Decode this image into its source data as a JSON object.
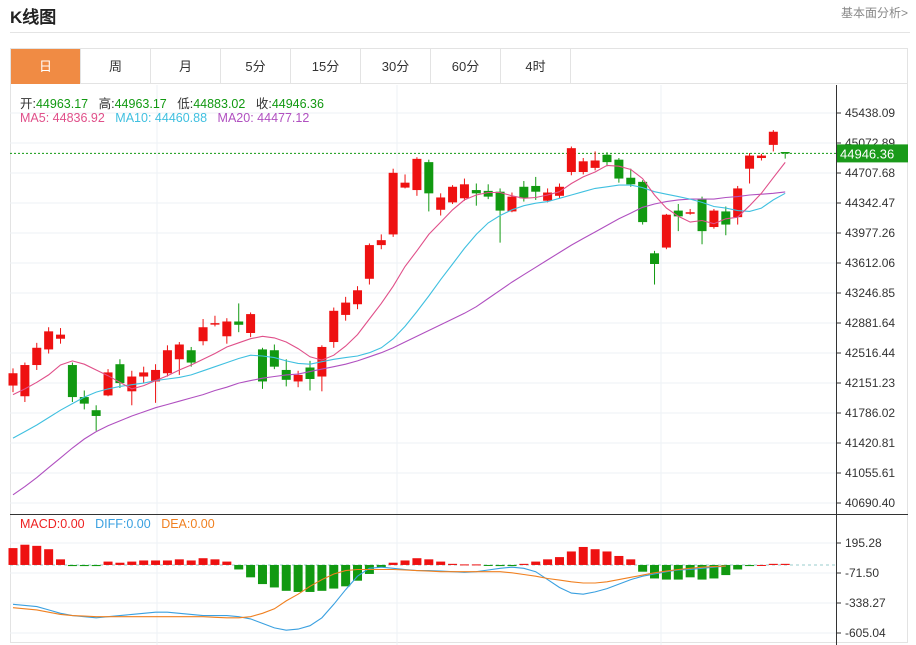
{
  "header": {
    "title": "K线图",
    "link": "基本面分析>"
  },
  "tabs": [
    {
      "label": "日",
      "active": true
    },
    {
      "label": "周",
      "active": false
    },
    {
      "label": "月",
      "active": false
    },
    {
      "label": "5分",
      "active": false
    },
    {
      "label": "15分",
      "active": false
    },
    {
      "label": "30分",
      "active": false
    },
    {
      "label": "60分",
      "active": false
    },
    {
      "label": "4时",
      "active": false
    }
  ],
  "ohlc_info": {
    "open_label": "开:",
    "open": "44963.17",
    "high_label": "高:",
    "high": "44963.17",
    "low_label": "低:",
    "low": "44883.02",
    "close_label": "收:",
    "close": "44946.36"
  },
  "ma_info": {
    "ma5_label": "MA5:",
    "ma5": "44836.92",
    "ma10_label": "MA10:",
    "ma10": "44460.88",
    "ma20_label": "MA20:",
    "ma20": "44477.12"
  },
  "macd_info": {
    "macd_label": "MACD:",
    "macd": "0.00",
    "diff_label": "DIFF:",
    "diff": "0.00",
    "dea_label": "DEA:",
    "dea": "0.00"
  },
  "colors": {
    "up": "#ee1111",
    "down": "#119911",
    "ma5": "#e0508a",
    "ma10": "#40c0e0",
    "ma20": "#b050c0",
    "diff": "#3aa0e0",
    "dea": "#f08020",
    "last_price_bg": "#1a9a1a"
  },
  "chart_data": {
    "type": "candlestick",
    "main_axis": {
      "ylim": [
        40690.4,
        45438.09
      ],
      "ticks": [
        "45438.09",
        "45072.89",
        "44707.68",
        "44342.47",
        "43977.26",
        "43612.06",
        "43246.85",
        "42881.64",
        "42516.44",
        "42151.23",
        "41786.02",
        "41420.81",
        "41055.61",
        "40690.40"
      ],
      "last_price_label": "44946.36",
      "last_price": 44946.36
    },
    "candles": [
      {
        "o": 42120,
        "c": 42270,
        "h": 42330,
        "l": 42040
      },
      {
        "o": 41990,
        "c": 42370,
        "h": 42400,
        "l": 41920
      },
      {
        "o": 42370,
        "c": 42580,
        "h": 42640,
        "l": 42310
      },
      {
        "o": 42560,
        "c": 42780,
        "h": 42830,
        "l": 42510
      },
      {
        "o": 42690,
        "c": 42740,
        "h": 42820,
        "l": 42630
      },
      {
        "o": 42370,
        "c": 41980,
        "h": 42400,
        "l": 41920
      },
      {
        "o": 41980,
        "c": 41900,
        "h": 42060,
        "l": 41830
      },
      {
        "o": 41820,
        "c": 41750,
        "h": 41880,
        "l": 41570
      },
      {
        "o": 42000,
        "c": 42280,
        "h": 42320,
        "l": 41990
      },
      {
        "o": 42380,
        "c": 42150,
        "h": 42440,
        "l": 42090
      },
      {
        "o": 42050,
        "c": 42230,
        "h": 42300,
        "l": 41880
      },
      {
        "o": 42230,
        "c": 42280,
        "h": 42350,
        "l": 42150
      },
      {
        "o": 42170,
        "c": 42310,
        "h": 42380,
        "l": 41910
      },
      {
        "o": 42270,
        "c": 42550,
        "h": 42610,
        "l": 42230
      },
      {
        "o": 42440,
        "c": 42620,
        "h": 42650,
        "l": 42250
      },
      {
        "o": 42550,
        "c": 42400,
        "h": 42590,
        "l": 42350
      },
      {
        "o": 42660,
        "c": 42830,
        "h": 42930,
        "l": 42610
      },
      {
        "o": 42880,
        "c": 42880,
        "h": 42970,
        "l": 42840
      },
      {
        "o": 42720,
        "c": 42900,
        "h": 42940,
        "l": 42630
      },
      {
        "o": 42900,
        "c": 42860,
        "h": 43120,
        "l": 42770
      },
      {
        "o": 42760,
        "c": 42990,
        "h": 43010,
        "l": 42710
      },
      {
        "o": 42560,
        "c": 42170,
        "h": 42580,
        "l": 42080
      },
      {
        "o": 42550,
        "c": 42350,
        "h": 42620,
        "l": 42320
      },
      {
        "o": 42310,
        "c": 42190,
        "h": 42440,
        "l": 42110
      },
      {
        "o": 42170,
        "c": 42250,
        "h": 42300,
        "l": 42100
      },
      {
        "o": 42340,
        "c": 42200,
        "h": 42420,
        "l": 42060
      },
      {
        "o": 42230,
        "c": 42590,
        "h": 42610,
        "l": 42050
      },
      {
        "o": 42650,
        "c": 43030,
        "h": 43070,
        "l": 42580
      },
      {
        "o": 42980,
        "c": 43130,
        "h": 43200,
        "l": 42910
      },
      {
        "o": 43110,
        "c": 43280,
        "h": 43330,
        "l": 43050
      },
      {
        "o": 43420,
        "c": 43830,
        "h": 43850,
        "l": 43350
      },
      {
        "o": 43830,
        "c": 43890,
        "h": 43960,
        "l": 43780
      },
      {
        "o": 43960,
        "c": 44710,
        "h": 44760,
        "l": 43930
      },
      {
        "o": 44530,
        "c": 44590,
        "h": 44690,
        "l": 44520
      },
      {
        "o": 44500,
        "c": 44880,
        "h": 44900,
        "l": 44430
      },
      {
        "o": 44840,
        "c": 44460,
        "h": 44870,
        "l": 44240
      },
      {
        "o": 44260,
        "c": 44410,
        "h": 44460,
        "l": 44190
      },
      {
        "o": 44350,
        "c": 44540,
        "h": 44560,
        "l": 44330
      },
      {
        "o": 44400,
        "c": 44570,
        "h": 44640,
        "l": 44370
      },
      {
        "o": 44500,
        "c": 44460,
        "h": 44580,
        "l": 44310
      },
      {
        "o": 44490,
        "c": 44420,
        "h": 44570,
        "l": 44390
      },
      {
        "o": 44480,
        "c": 44250,
        "h": 44520,
        "l": 43860
      },
      {
        "o": 44240,
        "c": 44420,
        "h": 44470,
        "l": 44230
      },
      {
        "o": 44540,
        "c": 44400,
        "h": 44610,
        "l": 44360
      },
      {
        "o": 44550,
        "c": 44480,
        "h": 44660,
        "l": 44380
      },
      {
        "o": 44370,
        "c": 44470,
        "h": 44520,
        "l": 44350
      },
      {
        "o": 44430,
        "c": 44540,
        "h": 44580,
        "l": 44400
      },
      {
        "o": 44720,
        "c": 45010,
        "h": 45030,
        "l": 44680
      },
      {
        "o": 44720,
        "c": 44850,
        "h": 44890,
        "l": 44690
      },
      {
        "o": 44770,
        "c": 44860,
        "h": 44970,
        "l": 44740
      },
      {
        "o": 44930,
        "c": 44840,
        "h": 44960,
        "l": 44790
      },
      {
        "o": 44870,
        "c": 44640,
        "h": 44890,
        "l": 44590
      },
      {
        "o": 44650,
        "c": 44570,
        "h": 44760,
        "l": 44540
      },
      {
        "o": 44600,
        "c": 44110,
        "h": 44620,
        "l": 44080
      },
      {
        "o": 43730,
        "c": 43600,
        "h": 43760,
        "l": 43350
      },
      {
        "o": 43800,
        "c": 44200,
        "h": 44210,
        "l": 43780
      },
      {
        "o": 44250,
        "c": 44180,
        "h": 44330,
        "l": 44000
      },
      {
        "o": 44220,
        "c": 44230,
        "h": 44270,
        "l": 44200
      },
      {
        "o": 44390,
        "c": 44000,
        "h": 44420,
        "l": 43840
      },
      {
        "o": 44050,
        "c": 44250,
        "h": 44270,
        "l": 44030
      },
      {
        "o": 44240,
        "c": 44080,
        "h": 44300,
        "l": 43950
      },
      {
        "o": 44170,
        "c": 44520,
        "h": 44550,
        "l": 44080
      },
      {
        "o": 44760,
        "c": 44920,
        "h": 44950,
        "l": 44580
      },
      {
        "o": 44890,
        "c": 44920,
        "h": 44940,
        "l": 44860
      },
      {
        "o": 45050,
        "c": 45210,
        "h": 45230,
        "l": 44970
      },
      {
        "o": 44963.17,
        "c": 44946.36,
        "h": 44963.17,
        "l": 44883.02
      }
    ],
    "ma5": [
      42010,
      42080,
      42160,
      42250,
      42370,
      42420,
      42380,
      42310,
      42240,
      42160,
      42080,
      42120,
      42180,
      42240,
      42310,
      42370,
      42440,
      42510,
      42590,
      42640,
      42690,
      42720,
      42700,
      42650,
      42570,
      42470,
      42430,
      42490,
      42600,
      42740,
      42930,
      43120,
      43330,
      43570,
      43760,
      43960,
      44110,
      44260,
      44380,
      44440,
      44470,
      44470,
      44430,
      44400,
      44410,
      44440,
      44480,
      44580,
      44660,
      44720,
      44800,
      44790,
      44750,
      44640,
      44440,
      44280,
      44180,
      44110,
      44130,
      44090,
      44150,
      44170,
      44310,
      44460,
      44650,
      44836.92
    ],
    "ma10": [
      41480,
      41560,
      41640,
      41730,
      41820,
      41900,
      41980,
      42040,
      42080,
      42110,
      42130,
      42150,
      42180,
      42200,
      42220,
      42250,
      42300,
      42350,
      42400,
      42450,
      42490,
      42480,
      42460,
      42420,
      42390,
      42380,
      42410,
      42440,
      42460,
      42480,
      42520,
      42580,
      42690,
      42840,
      43020,
      43210,
      43410,
      43600,
      43790,
      43960,
      44100,
      44190,
      44260,
      44310,
      44340,
      44360,
      44400,
      44440,
      44480,
      44520,
      44540,
      44560,
      44560,
      44530,
      44480,
      44450,
      44420,
      44390,
      44350,
      44300,
      44280,
      44250,
      44240,
      44280,
      44380,
      44460.88
    ],
    "ma20": [
      40790,
      40890,
      41000,
      41120,
      41240,
      41360,
      41470,
      41560,
      41630,
      41690,
      41750,
      41800,
      41850,
      41890,
      41930,
      41970,
      42010,
      42060,
      42100,
      42150,
      42180,
      42210,
      42230,
      42250,
      42260,
      42290,
      42320,
      42350,
      42380,
      42420,
      42470,
      42520,
      42580,
      42650,
      42720,
      42790,
      42860,
      42930,
      43000,
      43080,
      43180,
      43280,
      43380,
      43470,
      43560,
      43650,
      43740,
      43830,
      43910,
      43990,
      44070,
      44150,
      44220,
      44290,
      44330,
      44360,
      44380,
      44390,
      44390,
      44390,
      44410,
      44420,
      44440,
      44450,
      44460,
      44477.12
    ],
    "macd_axis": {
      "ylim": [
        -605.04,
        195.28
      ],
      "ticks": [
        "195.28",
        "-71.50",
        "-338.27",
        "-605.04"
      ]
    },
    "macd_hist": [
      150,
      180,
      170,
      140,
      50,
      -10,
      -10,
      -10,
      30,
      20,
      30,
      40,
      40,
      40,
      50,
      40,
      60,
      50,
      30,
      -40,
      -110,
      -170,
      -200,
      -230,
      -240,
      -240,
      -230,
      -210,
      -190,
      -140,
      -80,
      -20,
      20,
      40,
      60,
      50,
      30,
      10,
      5,
      5,
      -5,
      -10,
      -10,
      10,
      30,
      50,
      70,
      120,
      160,
      140,
      120,
      80,
      50,
      -60,
      -120,
      -130,
      -130,
      -110,
      -130,
      -120,
      -90,
      -40,
      -10,
      0,
      10,
      10
    ],
    "diff": [
      -350,
      -360,
      -370,
      -400,
      -430,
      -450,
      -460,
      -470,
      -460,
      -450,
      -440,
      -430,
      -420,
      -420,
      -430,
      -440,
      -450,
      -450,
      -450,
      -460,
      -480,
      -520,
      -560,
      -580,
      -570,
      -540,
      -470,
      -350,
      -220,
      -100,
      -30,
      -20,
      -30,
      -40,
      -50,
      -50,
      -55,
      -60,
      -65,
      -60,
      -45,
      -30,
      -20,
      -30,
      -60,
      -130,
      -200,
      -250,
      -260,
      -240,
      -210,
      -170,
      -130,
      -100,
      -80,
      -60,
      -45,
      -40,
      -30,
      -20,
      -10
    ],
    "dea": [
      -380,
      -390,
      -400,
      -420,
      -440,
      -450,
      -455,
      -460,
      -460,
      -460,
      -460,
      -460,
      -460,
      -460,
      -460,
      -460,
      -460,
      -465,
      -470,
      -470,
      -460,
      -430,
      -390,
      -320,
      -260,
      -190,
      -130,
      -80,
      -50,
      -40,
      -40,
      -40,
      -40,
      -45,
      -50,
      -55,
      -60,
      -60,
      -60,
      -60,
      -60,
      -60,
      -70,
      -85,
      -100,
      -120,
      -135,
      -150,
      -160,
      -160,
      -150,
      -130,
      -110,
      -90,
      -70,
      -55,
      -40,
      -30,
      -20,
      -15,
      -10
    ]
  }
}
